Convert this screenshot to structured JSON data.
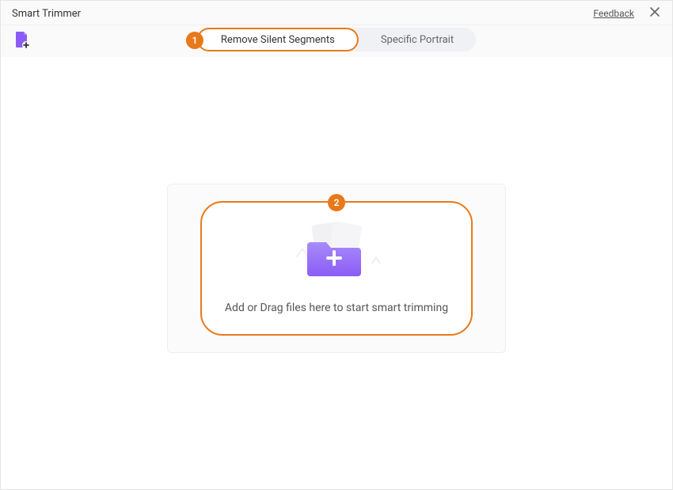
{
  "titlebar": {
    "title": "Smart Trimmer",
    "feedback": "Feedback"
  },
  "tabs": {
    "items": [
      {
        "label": "Remove Silent Segments"
      },
      {
        "label": "Specific Portrait"
      }
    ]
  },
  "callouts": {
    "one": "1",
    "two": "2"
  },
  "drop": {
    "text": "Add or Drag files here to start smart trimming"
  }
}
